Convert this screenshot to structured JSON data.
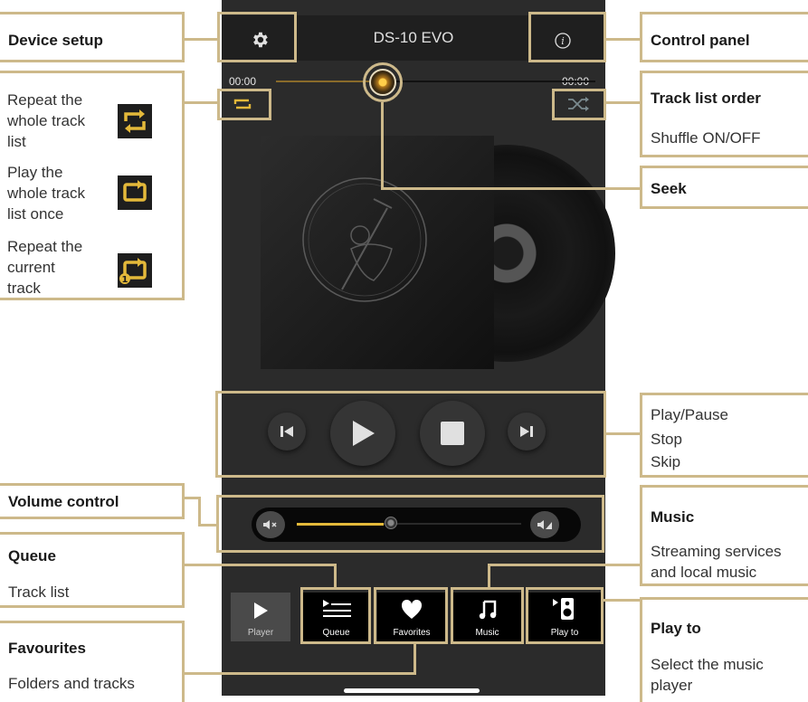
{
  "app": {
    "title": "DS-10 EVO",
    "time_start": "00:00",
    "time_end": "00:00",
    "seek_progress": 0.43,
    "volume_level": 0.36,
    "accent_color": "#e4b93a",
    "callout_border_color": "#cdb98a"
  },
  "callouts": {
    "device_setup": "Device setup",
    "control_panel": "Control panel",
    "repeat_all": "Repeat the whole track list",
    "play_once": "Play the whole track list once",
    "repeat_one": "Repeat the current track",
    "track_order_title": "Track list order",
    "track_order_desc": "Shuffle ON/OFF",
    "seek": "Seek",
    "transport_play": "Play/Pause",
    "transport_stop": "Stop",
    "transport_skip": "Skip",
    "volume": "Volume control",
    "queue_title": "Queue",
    "queue_desc": "Track list",
    "music_title": "Music",
    "music_desc": "Streaming services and local music",
    "favourites_title": "Favourites",
    "favourites_desc": "Folders and tracks",
    "playto_title": "Play to",
    "playto_desc": "Select the music player"
  },
  "tabs": {
    "player": "Player",
    "queue": "Queue",
    "favorites": "Favorites",
    "music": "Music",
    "play_to": "Play to"
  },
  "icons": [
    "gear-icon",
    "info-icon",
    "repeat-icon",
    "shuffle-icon",
    "previous-icon",
    "play-icon",
    "stop-icon",
    "next-icon",
    "mute-icon",
    "volume-icon",
    "queue-icon",
    "heart-icon",
    "music-note-icon",
    "speaker-icon"
  ]
}
